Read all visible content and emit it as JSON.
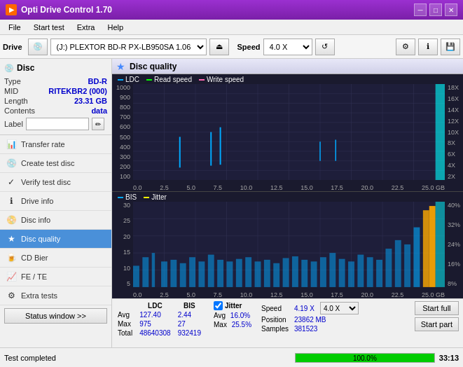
{
  "app": {
    "title": "Opti Drive Control 1.70",
    "icon": "⬡"
  },
  "titlebar": {
    "minimize": "─",
    "maximize": "□",
    "close": "✕"
  },
  "menubar": {
    "items": [
      "File",
      "Start test",
      "Extra",
      "Help"
    ]
  },
  "toolbar": {
    "drive_label": "Drive",
    "drive_value": "(J:) PLEXTOR BD-R  PX-LB950SA 1.06",
    "speed_label": "Speed",
    "speed_value": "4.0 X"
  },
  "disc": {
    "title": "Disc",
    "type_label": "Type",
    "type_value": "BD-R",
    "mid_label": "MID",
    "mid_value": "RITEKBR2 (000)",
    "length_label": "Length",
    "length_value": "23.31 GB",
    "contents_label": "Contents",
    "contents_value": "data",
    "label_label": "Label",
    "label_value": ""
  },
  "sidebar_nav": [
    {
      "id": "transfer-rate",
      "label": "Transfer rate",
      "icon": "📊"
    },
    {
      "id": "create-test-disc",
      "label": "Create test disc",
      "icon": "💿"
    },
    {
      "id": "verify-test-disc",
      "label": "Verify test disc",
      "icon": "✓"
    },
    {
      "id": "drive-info",
      "label": "Drive info",
      "icon": "ℹ"
    },
    {
      "id": "disc-info",
      "label": "Disc info",
      "icon": "📀"
    },
    {
      "id": "disc-quality",
      "label": "Disc quality",
      "icon": "★",
      "active": true
    },
    {
      "id": "cd-bier",
      "label": "CD Bier",
      "icon": "🍺"
    },
    {
      "id": "fe-te",
      "label": "FE / TE",
      "icon": "📈"
    },
    {
      "id": "extra-tests",
      "label": "Extra tests",
      "icon": "⚙"
    }
  ],
  "status_btn": "Status window >>",
  "panel": {
    "title": "Disc quality",
    "icon": "★"
  },
  "chart1": {
    "legend": [
      {
        "id": "ldc",
        "label": "LDC",
        "color": "#00aaff"
      },
      {
        "id": "read",
        "label": "Read speed",
        "color": "#00ff00"
      },
      {
        "id": "write",
        "label": "Write speed",
        "color": "#ff69b4"
      }
    ],
    "y_left": [
      "1000",
      "900",
      "800",
      "700",
      "600",
      "500",
      "400",
      "300",
      "200",
      "100"
    ],
    "y_right": [
      "18X",
      "16X",
      "14X",
      "12X",
      "10X",
      "8X",
      "6X",
      "4X",
      "2X"
    ],
    "x_labels": [
      "0.0",
      "2.5",
      "5.0",
      "7.5",
      "10.0",
      "12.5",
      "15.0",
      "17.5",
      "20.0",
      "22.5",
      "25.0 GB"
    ]
  },
  "chart2": {
    "legend": [
      {
        "id": "bis",
        "label": "BIS",
        "color": "#00aaff"
      },
      {
        "id": "jitter",
        "label": "Jitter",
        "color": "#ffff00"
      }
    ],
    "y_left": [
      "30",
      "25",
      "20",
      "15",
      "10",
      "5"
    ],
    "y_right": [
      "40%",
      "32%",
      "24%",
      "16%",
      "8%"
    ],
    "x_labels": [
      "0.0",
      "2.5",
      "5.0",
      "7.5",
      "10.0",
      "12.5",
      "15.0",
      "17.5",
      "20.0",
      "22.5",
      "25.0 GB"
    ]
  },
  "stats": {
    "headers": [
      "",
      "LDC",
      "BIS"
    ],
    "rows": [
      {
        "label": "Avg",
        "ldc": "127.40",
        "bis": "2.44"
      },
      {
        "label": "Max",
        "ldc": "975",
        "bis": "27"
      },
      {
        "label": "Total",
        "ldc": "48640308",
        "bis": "932419"
      }
    ],
    "jitter": {
      "checked": true,
      "label": "Jitter",
      "rows": [
        {
          "label": "Avg",
          "value": "16.0%"
        },
        {
          "label": "Max",
          "value": "25.5%"
        }
      ]
    },
    "speed": {
      "label": "Speed",
      "value": "4.19 X",
      "select": "4.0 X",
      "position_label": "Position",
      "position_value": "23862 MB",
      "samples_label": "Samples",
      "samples_value": "381523"
    },
    "buttons": {
      "start_full": "Start full",
      "start_part": "Start part"
    }
  },
  "statusbar": {
    "text": "Test completed",
    "progress": 100,
    "progress_text": "100.0%",
    "time": "33:13"
  }
}
